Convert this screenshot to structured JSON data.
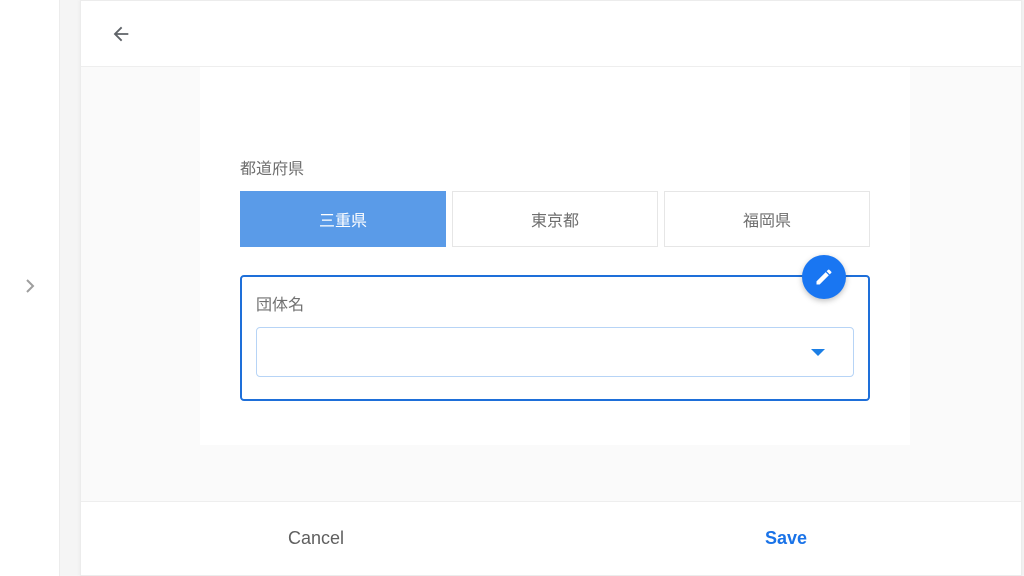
{
  "form": {
    "prefecture_label": "都道府県",
    "prefectures": {
      "option1": "三重県",
      "option2": "東京都",
      "option3": "福岡県",
      "selected_index": 0
    },
    "organization_label": "団体名",
    "organization_value": ""
  },
  "footer": {
    "cancel": "Cancel",
    "save": "Save"
  }
}
